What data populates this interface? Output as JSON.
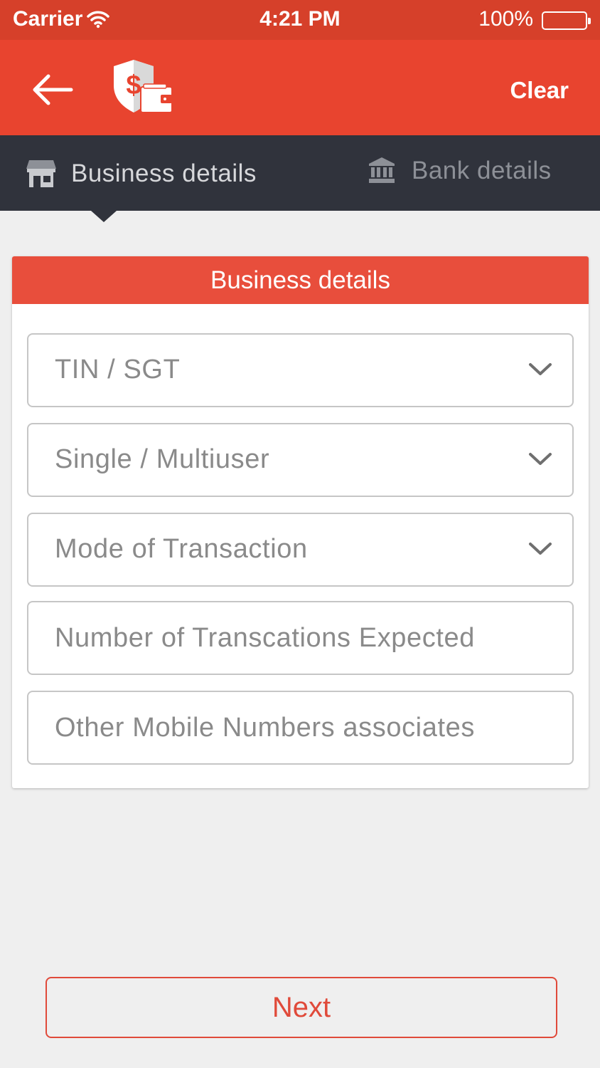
{
  "status_bar": {
    "carrier": "Carrier",
    "time": "4:21 PM",
    "battery": "100%"
  },
  "app_bar": {
    "back_icon": "arrow-left-icon",
    "logo_icon": "shield-dollar-wallet-icon",
    "clear_label": "Clear"
  },
  "tabs": [
    {
      "label": "Business details",
      "icon": "store-icon",
      "active": true
    },
    {
      "label": "Bank details",
      "icon": "bank-icon",
      "active": false
    }
  ],
  "form": {
    "title": "Business details",
    "tin_sgt": {
      "label": "TIN / SGT",
      "icon": "chevron-down-icon"
    },
    "user_type": {
      "label": "Single / Multiuser",
      "icon": "chevron-down-icon"
    },
    "transaction_mode": {
      "label": "Mode of Transaction",
      "icon": "chevron-down-icon"
    },
    "transactions_expected": {
      "placeholder": "Number of Transcations Expected",
      "value": ""
    },
    "other_mobile_numbers": {
      "placeholder": "Other Mobile Numbers associates",
      "value": ""
    }
  },
  "next_label": "Next",
  "colors": {
    "status_bar": "#d6402a",
    "app_bar": "#e8442f",
    "tab_bar": "#30333c",
    "card_header": "#e84e3c",
    "accent": "#e04a3a",
    "background": "#efefef"
  }
}
